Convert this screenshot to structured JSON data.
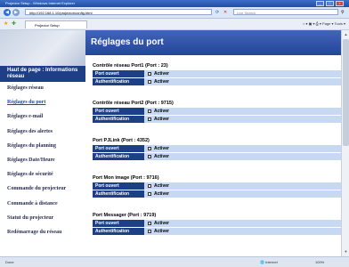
{
  "window": {
    "title": "Projector Setup - Windows Internet Explorer",
    "controls": [
      "_",
      "□",
      "×"
    ]
  },
  "browser": {
    "address": "http://192.168.1.10/projector/config.html",
    "search_placeholder": "Live Search",
    "tab_label": "Projector Setup",
    "toolbar": "⌂ ▾  ▣ ▾  ⎙ ▾  Page ▾  Tools ▾",
    "status_left": "Done",
    "status_zone": "Internet",
    "status_zoom": "100%"
  },
  "sidebar": {
    "home_label": "Haut de page : Informations réseau",
    "items": [
      {
        "label": "Réglages réseau"
      },
      {
        "label": "Réglages du port"
      },
      {
        "label": "Réglages e-mail"
      },
      {
        "label": "Réglages des alertes"
      },
      {
        "label": "Réglages du planning"
      },
      {
        "label": "Réglages Date/Heure"
      },
      {
        "label": "Réglages de sécurité"
      },
      {
        "label": "Commande du projecteur"
      },
      {
        "label": "Commande à distance"
      },
      {
        "label": "Statut du projecteur"
      },
      {
        "label": "Redémarrage du réseau"
      }
    ]
  },
  "page": {
    "title": "Réglages du port"
  },
  "sections": [
    {
      "title": "Contrôle réseau Port1 (Port : 23)",
      "rows": [
        {
          "label": "Port ouvert",
          "value": "Activer"
        },
        {
          "label": "Authentification",
          "value": "Activer"
        }
      ]
    },
    {
      "title": "Contrôle réseau Port2 (Port : 9715)",
      "rows": [
        {
          "label": "Port ouvert",
          "value": "Activer"
        },
        {
          "label": "Authentification",
          "value": "Activer"
        }
      ]
    },
    {
      "title": "Port PJLink (Port : 4352)",
      "rows": [
        {
          "label": "Port ouvert",
          "value": "Activer"
        },
        {
          "label": "Authentification",
          "value": "Activer"
        }
      ]
    },
    {
      "title": "Port Mon image (Port : 9716)",
      "rows": [
        {
          "label": "Port ouvert",
          "value": "Activer"
        },
        {
          "label": "Authentification",
          "value": "Activer"
        }
      ]
    },
    {
      "title": "Port Messager (Port : 9719)",
      "rows": [
        {
          "label": "Port ouvert",
          "value": "Activer"
        },
        {
          "label": "Authentification",
          "value": "Activer"
        }
      ]
    }
  ]
}
